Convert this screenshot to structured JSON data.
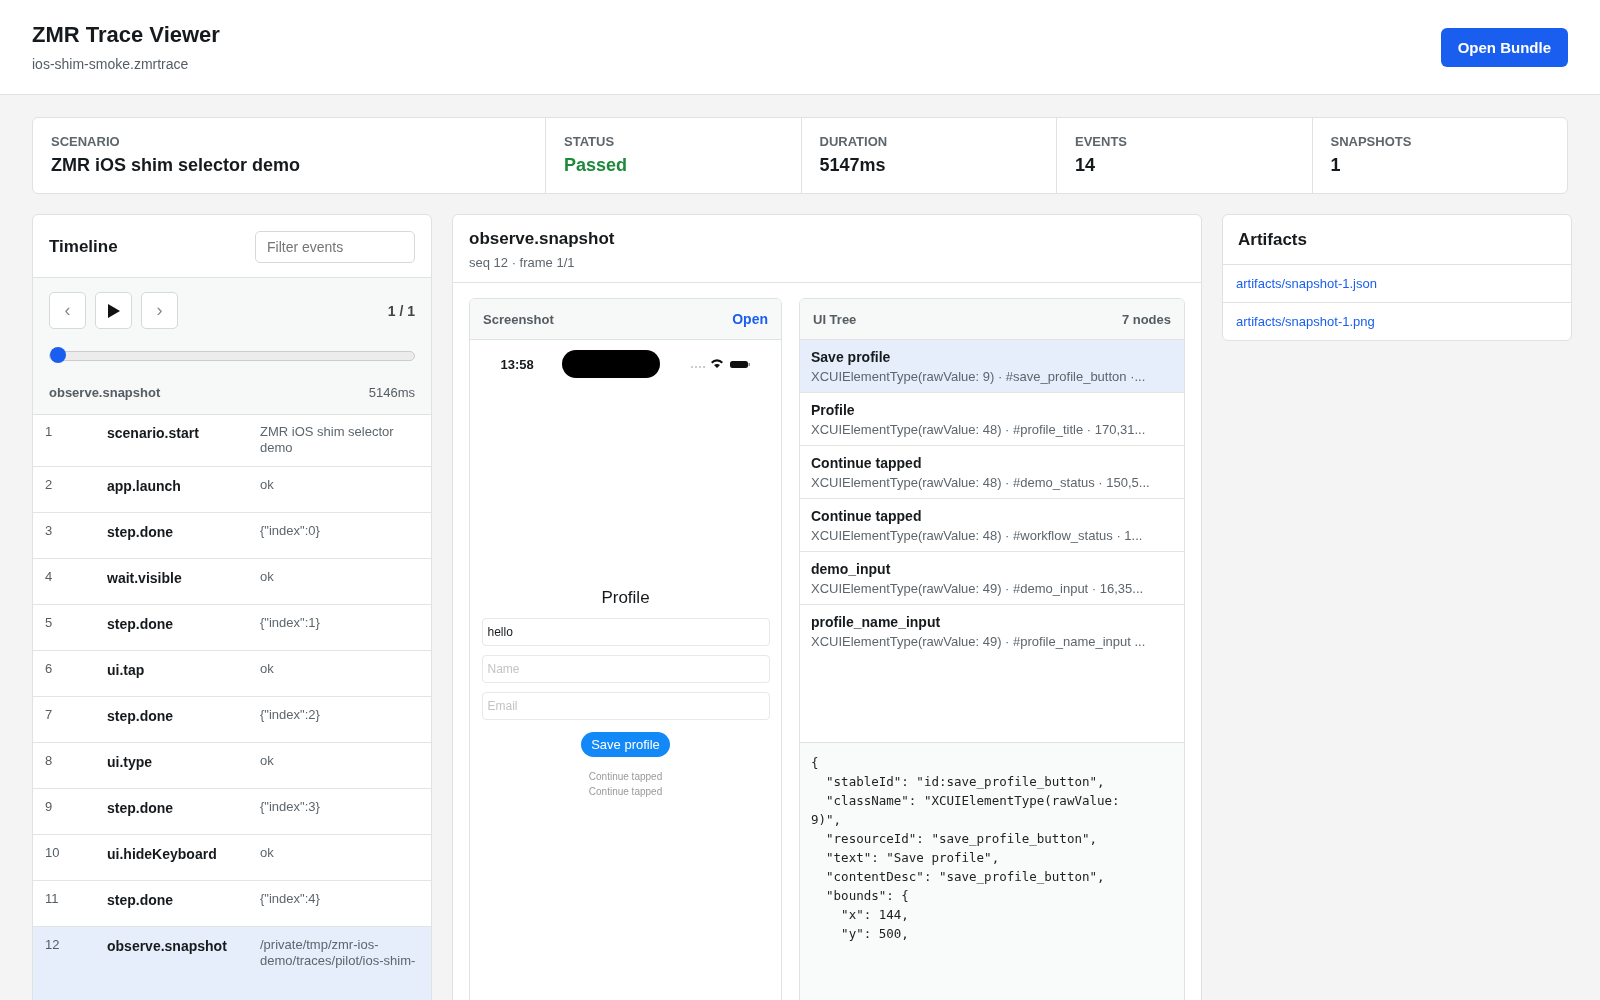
{
  "header": {
    "title": "ZMR Trace Viewer",
    "subtitle": "ios-shim-smoke.zmrtrace",
    "open_button": "Open Bundle"
  },
  "summary": [
    {
      "label": "SCENARIO",
      "value": "ZMR iOS shim selector demo",
      "kind": "plain"
    },
    {
      "label": "STATUS",
      "value": "Passed",
      "kind": "success"
    },
    {
      "label": "DURATION",
      "value": "5147ms",
      "kind": "plain"
    },
    {
      "label": "EVENTS",
      "value": "14",
      "kind": "plain"
    },
    {
      "label": "SNAPSHOTS",
      "value": "1",
      "kind": "plain"
    }
  ],
  "timeline": {
    "title": "Timeline",
    "filter_placeholder": "Filter events",
    "prev": "‹",
    "next": "›",
    "counter": "1 / 1",
    "scrubber": {
      "level": 0
    },
    "current_event": "observe.snapshot",
    "current_time": "5146ms",
    "events": [
      {
        "seq": "1",
        "name": "scenario.start",
        "detail": "ZMR iOS shim selector demo",
        "selected": false
      },
      {
        "seq": "2",
        "name": "app.launch",
        "detail": "ok",
        "selected": false
      },
      {
        "seq": "3",
        "name": "step.done",
        "detail": "{\"index\":0}",
        "selected": false
      },
      {
        "seq": "4",
        "name": "wait.visible",
        "detail": "ok",
        "selected": false
      },
      {
        "seq": "5",
        "name": "step.done",
        "detail": "{\"index\":1}",
        "selected": false
      },
      {
        "seq": "6",
        "name": "ui.tap",
        "detail": "ok",
        "selected": false
      },
      {
        "seq": "7",
        "name": "step.done",
        "detail": "{\"index\":2}",
        "selected": false
      },
      {
        "seq": "8",
        "name": "ui.type",
        "detail": "ok",
        "selected": false
      },
      {
        "seq": "9",
        "name": "step.done",
        "detail": "{\"index\":3}",
        "selected": false
      },
      {
        "seq": "10",
        "name": "ui.hideKeyboard",
        "detail": "ok",
        "selected": false
      },
      {
        "seq": "11",
        "name": "step.done",
        "detail": "{\"index\":4}",
        "selected": false
      },
      {
        "seq": "12",
        "name": "observe.snapshot",
        "detail": "/private/tmp/zmr-ios-demo/traces/pilot/ios-shim-",
        "selected": true
      }
    ]
  },
  "detail": {
    "title": "observe.snapshot",
    "subtitle": "seq 12 · frame 1/1",
    "screenshot": {
      "title": "Screenshot",
      "open_link": "Open",
      "phone": {
        "time": "13:58",
        "heading": "Profile",
        "fields": [
          {
            "value": "hello"
          },
          {
            "placeholder": "Name"
          },
          {
            "placeholder": "Email"
          }
        ],
        "button": "Save profile",
        "status_lines": [
          "Continue tapped",
          "Continue tapped"
        ]
      }
    },
    "ui_tree": {
      "title": "UI Tree",
      "count": "7 nodes",
      "nodes": [
        {
          "label": "Save profile",
          "meta": "XCUIElementType(rawValue: 9) · #save_profile_button ·...",
          "selected": true
        },
        {
          "label": "Profile",
          "meta": "XCUIElementType(rawValue: 48) · #profile_title · 170,31...",
          "selected": false
        },
        {
          "label": "Continue tapped",
          "meta": "XCUIElementType(rawValue: 48) · #demo_status · 150,5...",
          "selected": false
        },
        {
          "label": "Continue tapped",
          "meta": "XCUIElementType(rawValue: 48) · #workflow_status · 1...",
          "selected": false
        },
        {
          "label": "demo_input",
          "meta": "XCUIElementType(rawValue: 49) · #demo_input · 16,35...",
          "selected": false
        },
        {
          "label": "profile_name_input",
          "meta": "XCUIElementType(rawValue: 49) · #profile_name_input ...",
          "selected": false
        }
      ],
      "node_json": [
        "{",
        "  \"stableId\": \"id:save_profile_button\",",
        "  \"className\": \"XCUIElementType(rawValue:",
        "9)\",",
        "  \"resourceId\": \"save_profile_button\",",
        "  \"text\": \"Save profile\",",
        "  \"contentDesc\": \"save_profile_button\",",
        "  \"bounds\": {",
        "    \"x\": 144,",
        "    \"y\": 500,"
      ]
    }
  },
  "artifacts": {
    "title": "Artifacts",
    "files": [
      "artifacts/snapshot-1.json",
      "artifacts/snapshot-1.png"
    ]
  }
}
